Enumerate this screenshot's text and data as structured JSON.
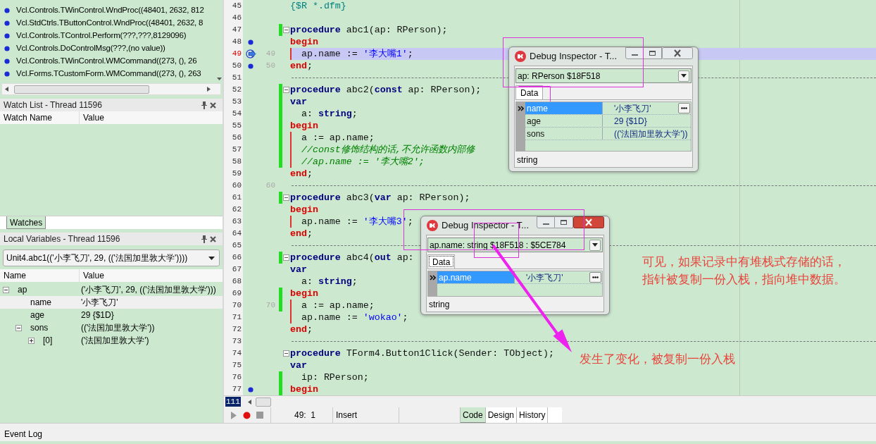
{
  "call_stack": {
    "rows": [
      {
        "text": "Vcl.Controls.TWinControl.WndProc((48401, 2632, 812"
      },
      {
        "text": "Vcl.StdCtrls.TButtonControl.WndProc((48401, 2632, 8"
      },
      {
        "text": "Vcl.Controls.TControl.Perform(???,???,8129096)"
      },
      {
        "text": "Vcl.Controls.DoControlMsg(???,(no value))"
      },
      {
        "text": "Vcl.Controls.TWinControl.WMCommand((273, (), 26"
      },
      {
        "text": "Vcl.Forms.TCustomForm.WMCommand((273, (), 263"
      }
    ]
  },
  "watch_list": {
    "title": "Watch List - Thread 11596",
    "columns": [
      "Watch Name",
      "Value"
    ]
  },
  "bottom_tabs": [
    {
      "label": "Watches",
      "selected": true
    }
  ],
  "local_variables": {
    "title": "Local Variables - Thread 11596",
    "frame": "Unit4.abc1(('小李飞刀', 29, (('法国加里敦大学'))))",
    "columns": [
      "Name",
      "Value"
    ],
    "tree": [
      {
        "name": "ap",
        "value": "('小李飞刀', 29, (('法国加里敦大学')))",
        "selected": false,
        "expanded": true,
        "children": [
          {
            "name": "name",
            "value": "'小李飞刀'",
            "selected": true
          },
          {
            "name": "age",
            "value": "29 {$1D}",
            "selected": false
          },
          {
            "name": "sons",
            "value": "(('法国加里敦大学'))",
            "selected": false,
            "expanded": true,
            "children": [
              {
                "name": "[0]",
                "value": "('法国加里敦大学')",
                "selected": false,
                "expanded": false
              }
            ]
          }
        ]
      }
    ]
  },
  "editor": {
    "lines": [
      {
        "number": "45",
        "breakpoint": false,
        "current": false,
        "modified": false,
        "in_block": false,
        "separator": false,
        "fold": false,
        "code": [
          {
            "kind": "directive",
            "text": "{$R *.dfm}"
          }
        ]
      },
      {
        "number": "46",
        "breakpoint": false,
        "current": false,
        "modified": false,
        "in_block": false,
        "separator": false,
        "fold": false
      },
      {
        "number": "47",
        "breakpoint": false,
        "current": false,
        "modified": true,
        "in_block": false,
        "separator": false,
        "fold": true,
        "code": [
          {
            "kind": "keyword",
            "text": "procedure"
          },
          {
            "kind": "plain",
            "text": " abc1(ap: RPerson);"
          }
        ]
      },
      {
        "number": "48",
        "breakpoint": true,
        "current": false,
        "modified": false,
        "in_block": false,
        "separator": false,
        "fold": false,
        "code": [
          {
            "kind": "block",
            "text": "begin"
          }
        ]
      },
      {
        "number": "49",
        "caption": "49",
        "breakpoint": false,
        "current": true,
        "modified": false,
        "in_block": true,
        "separator": false,
        "fold": false,
        "code": [
          {
            "kind": "plain",
            "text": "  ap.name := "
          },
          {
            "kind": "string",
            "text": "'李大嘴1'"
          },
          {
            "kind": "plain",
            "text": ";"
          }
        ]
      },
      {
        "number": "50",
        "caption": "50",
        "breakpoint": true,
        "current": false,
        "modified": false,
        "in_block": false,
        "separator": false,
        "fold": false,
        "code": [
          {
            "kind": "block",
            "text": "end"
          },
          {
            "kind": "plain",
            "text": ";"
          }
        ]
      },
      {
        "number": "51",
        "breakpoint": false,
        "current": false,
        "modified": false,
        "in_block": false,
        "separator": true,
        "fold": false
      },
      {
        "number": "52",
        "breakpoint": false,
        "current": false,
        "modified": true,
        "in_block": false,
        "separator": false,
        "fold": true,
        "code": [
          {
            "kind": "keyword",
            "text": "procedure"
          },
          {
            "kind": "plain",
            "text": " abc2("
          },
          {
            "kind": "keyword",
            "text": "const"
          },
          {
            "kind": "plain",
            "text": " ap: RPerson);"
          }
        ]
      },
      {
        "number": "53",
        "breakpoint": false,
        "current": false,
        "modified": true,
        "in_block": false,
        "separator": false,
        "fold": false,
        "code": [
          {
            "kind": "keyword",
            "text": "var"
          }
        ]
      },
      {
        "number": "54",
        "breakpoint": false,
        "current": false,
        "modified": true,
        "in_block": false,
        "separator": false,
        "fold": false,
        "code": [
          {
            "kind": "plain",
            "text": "  a: "
          },
          {
            "kind": "keyword",
            "text": "string"
          },
          {
            "kind": "plain",
            "text": ";"
          }
        ]
      },
      {
        "number": "55",
        "breakpoint": false,
        "current": false,
        "modified": true,
        "in_block": false,
        "separator": false,
        "fold": false,
        "code": [
          {
            "kind": "block",
            "text": "begin"
          }
        ]
      },
      {
        "number": "56",
        "breakpoint": false,
        "current": false,
        "modified": true,
        "in_block": true,
        "separator": false,
        "fold": false,
        "code": [
          {
            "kind": "plain",
            "text": "  a := ap.name;"
          }
        ]
      },
      {
        "number": "57",
        "breakpoint": false,
        "current": false,
        "modified": true,
        "in_block": true,
        "separator": false,
        "fold": false,
        "code": [
          {
            "kind": "comment",
            "text": "  //const修饰结构的话,不允许函数内部修"
          }
        ]
      },
      {
        "number": "58",
        "breakpoint": false,
        "current": false,
        "modified": true,
        "in_block": true,
        "separator": false,
        "fold": false,
        "code": [
          {
            "kind": "comment",
            "text": "  //ap.name := '李大嘴2';"
          }
        ]
      },
      {
        "number": "59",
        "breakpoint": false,
        "current": false,
        "modified": false,
        "in_block": false,
        "separator": false,
        "fold": false,
        "code": [
          {
            "kind": "block",
            "text": "end"
          },
          {
            "kind": "plain",
            "text": ";"
          }
        ]
      },
      {
        "number": "60",
        "caption": "60",
        "breakpoint": false,
        "current": false,
        "modified": false,
        "in_block": false,
        "separator": true,
        "fold": false
      },
      {
        "number": "61",
        "breakpoint": false,
        "current": false,
        "modified": true,
        "in_block": false,
        "separator": false,
        "fold": true,
        "code": [
          {
            "kind": "keyword",
            "text": "procedure"
          },
          {
            "kind": "plain",
            "text": " abc3("
          },
          {
            "kind": "keyword",
            "text": "var"
          },
          {
            "kind": "plain",
            "text": " ap: RPerson);"
          }
        ]
      },
      {
        "number": "62",
        "breakpoint": false,
        "current": false,
        "modified": false,
        "in_block": false,
        "separator": false,
        "fold": false,
        "code": [
          {
            "kind": "block",
            "text": "begin"
          }
        ]
      },
      {
        "number": "63",
        "breakpoint": false,
        "current": false,
        "modified": false,
        "in_block": true,
        "separator": false,
        "fold": false,
        "code": [
          {
            "kind": "plain",
            "text": "  ap.name := "
          },
          {
            "kind": "string",
            "text": "'李大嘴3'"
          },
          {
            "kind": "plain",
            "text": ";"
          }
        ]
      },
      {
        "number": "64",
        "breakpoint": false,
        "current": false,
        "modified": false,
        "in_block": false,
        "separator": false,
        "fold": false,
        "code": [
          {
            "kind": "block",
            "text": "end"
          },
          {
            "kind": "plain",
            "text": ";"
          }
        ]
      },
      {
        "number": "65",
        "breakpoint": false,
        "current": false,
        "modified": false,
        "in_block": false,
        "separator": true,
        "fold": false
      },
      {
        "number": "66",
        "breakpoint": false,
        "current": false,
        "modified": true,
        "in_block": false,
        "separator": false,
        "fold": true,
        "code": [
          {
            "kind": "keyword",
            "text": "procedure"
          },
          {
            "kind": "plain",
            "text": " abc4("
          },
          {
            "kind": "keyword",
            "text": "out"
          },
          {
            "kind": "plain",
            "text": " ap:"
          }
        ]
      },
      {
        "number": "67",
        "breakpoint": false,
        "current": false,
        "modified": false,
        "in_block": false,
        "separator": false,
        "fold": false,
        "code": [
          {
            "kind": "keyword",
            "text": "var"
          }
        ]
      },
      {
        "number": "68",
        "breakpoint": false,
        "current": false,
        "modified": false,
        "in_block": false,
        "separator": false,
        "fold": false,
        "code": [
          {
            "kind": "plain",
            "text": "  a: "
          },
          {
            "kind": "keyword",
            "text": "string"
          },
          {
            "kind": "plain",
            "text": ";"
          }
        ]
      },
      {
        "number": "69",
        "breakpoint": false,
        "current": false,
        "modified": true,
        "in_block": false,
        "separator": false,
        "fold": false,
        "code": [
          {
            "kind": "block",
            "text": "begin"
          }
        ]
      },
      {
        "number": "70",
        "caption": "70",
        "breakpoint": false,
        "current": false,
        "modified": true,
        "in_block": true,
        "separator": false,
        "fold": false,
        "code": [
          {
            "kind": "plain",
            "text": "  a := ap.name;"
          }
        ]
      },
      {
        "number": "71",
        "breakpoint": false,
        "current": false,
        "modified": false,
        "in_block": true,
        "separator": false,
        "fold": false,
        "code": [
          {
            "kind": "plain",
            "text": "  ap.name := "
          },
          {
            "kind": "string",
            "text": "'wokao'"
          },
          {
            "kind": "plain",
            "text": ";"
          }
        ]
      },
      {
        "number": "72",
        "breakpoint": false,
        "current": false,
        "modified": false,
        "in_block": false,
        "separator": false,
        "fold": false,
        "code": [
          {
            "kind": "block",
            "text": "end"
          },
          {
            "kind": "plain",
            "text": ";"
          }
        ]
      },
      {
        "number": "73",
        "breakpoint": false,
        "current": false,
        "modified": false,
        "in_block": false,
        "separator": true,
        "fold": false
      },
      {
        "number": "74",
        "breakpoint": false,
        "current": false,
        "modified": false,
        "in_block": false,
        "separator": false,
        "fold": true,
        "code": [
          {
            "kind": "keyword",
            "text": "procedure"
          },
          {
            "kind": "plain",
            "text": " TForm4.Button1Click(Sender: TObject);"
          }
        ]
      },
      {
        "number": "75",
        "breakpoint": false,
        "current": false,
        "modified": false,
        "in_block": false,
        "separator": false,
        "fold": false,
        "code": [
          {
            "kind": "keyword",
            "text": "var"
          }
        ]
      },
      {
        "number": "76",
        "breakpoint": false,
        "current": false,
        "modified": true,
        "in_block": false,
        "separator": false,
        "fold": false,
        "code": [
          {
            "kind": "plain",
            "text": "  ip: RPerson;"
          }
        ]
      },
      {
        "number": "77",
        "breakpoint": true,
        "current": false,
        "modified": true,
        "in_block": false,
        "separator": false,
        "fold": false,
        "code": [
          {
            "kind": "block",
            "text": "begin"
          }
        ]
      }
    ],
    "line_count": "111"
  },
  "inspectors": [
    {
      "title": "Debug Inspector - T...",
      "active": false,
      "expression": "ap: RPerson $18F518",
      "tabs": [
        {
          "label": "Data",
          "selected": true
        }
      ],
      "rows": [
        {
          "name": "name",
          "value": "'小李飞刀'",
          "selected": true
        },
        {
          "name": "age",
          "value": "29 {$1D}",
          "selected": false
        },
        {
          "name": "sons",
          "value": "(('法国加里敦大学'))",
          "selected": false
        }
      ],
      "type": "string"
    },
    {
      "title": "Debug Inspector - T...",
      "active": true,
      "expression": "ap.name: string $18F518 : $5CE784",
      "tabs": [
        {
          "label": "Data",
          "selected": true
        }
      ],
      "rows": [
        {
          "name": "ap.name",
          "value": "'小李飞刀'",
          "selected": true
        }
      ],
      "type": "string"
    }
  ],
  "annotations": [
    {
      "text": "可见，如果记录中有堆栈式存储的话，"
    },
    {
      "text": "指针被复制一份入栈，指向堆中数据。"
    },
    {
      "text": "发生了变化，被复制一份入栈"
    }
  ],
  "status_bar": {
    "position": "49:  1",
    "mode": "Insert",
    "view_tabs": [
      {
        "label": "Code",
        "selected": true
      },
      {
        "label": "Design",
        "selected": false
      },
      {
        "label": "History",
        "selected": false
      }
    ]
  },
  "event_log": {
    "title": "Event Log"
  }
}
